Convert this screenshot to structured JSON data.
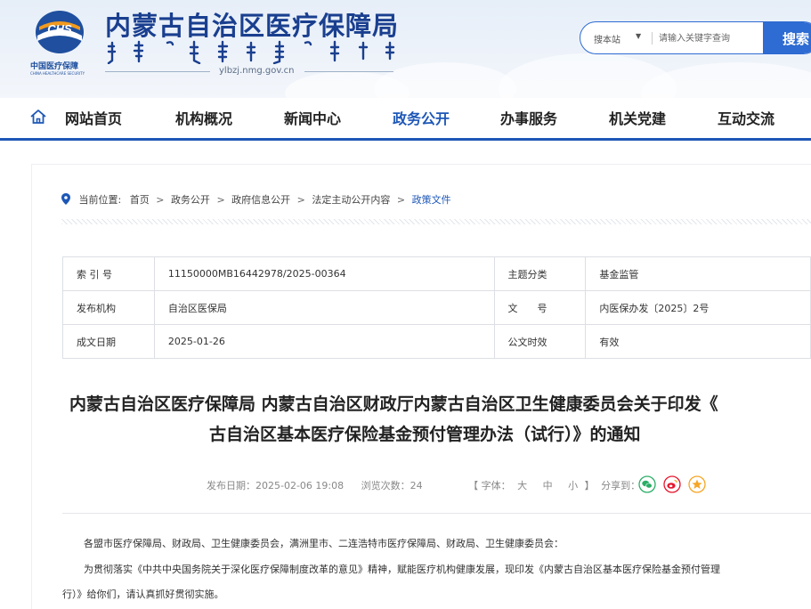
{
  "header": {
    "title": "内蒙古自治区医疗保障局",
    "domain": "ylbzj.nmg.gov.cn",
    "logo_abbr": "CHS",
    "logo_cn": "中国医疗保障",
    "logo_en": "CHINA HEALTHCARE SECURITY"
  },
  "search": {
    "scope": "搜本站",
    "placeholder": "请输入关键字查询",
    "button": "搜索"
  },
  "nav": {
    "items": [
      {
        "label": "网站首页"
      },
      {
        "label": "机构概况"
      },
      {
        "label": "新闻中心"
      },
      {
        "label": "政务公开"
      },
      {
        "label": "办事服务"
      },
      {
        "label": "机关党建"
      },
      {
        "label": "互动交流"
      }
    ],
    "active_index": 3
  },
  "breadcrumb": {
    "prefix": "当前位置:",
    "items": [
      "首页",
      "政务公开",
      "政府信息公开",
      "法定主动公开内容",
      "政策文件"
    ],
    "separator": ">"
  },
  "meta_table": [
    {
      "k1": "索 引 号",
      "v1": "11150000MB16442978/2025-00364",
      "k2": "主题分类",
      "v2": "基金监管"
    },
    {
      "k1": "发布机构",
      "v1": "自治区医保局",
      "k2": "文　　号",
      "v2": "内医保办发〔2025〕2号"
    },
    {
      "k1": "成文日期",
      "v1": "2025-01-26",
      "k2": "公文时效",
      "v2": "有效"
    }
  ],
  "article": {
    "title_line1": "内蒙古自治区医疗保障局 内蒙古自治区财政厅内蒙古自治区卫生健康委员会关于印发《",
    "title_line2": "古自治区基本医疗保险基金预付管理办法（试行）》的通知",
    "publish_label": "发布日期：2025-02-06 19:08",
    "views_label": "浏览次数：24",
    "font_label": "【 字体：",
    "font_large": "大",
    "font_medium": "中",
    "font_small": "小",
    "font_close": "】",
    "share_label": "分享到：",
    "para1": "各盟市医疗保障局、财政局、卫生健康委员会，满洲里市、二连浩特市医疗保障局、财政局、卫生健康委员会：",
    "para2": "为贯彻落实《中共中央国务院关于深化医疗保障制度改革的意见》精神，赋能医疗机构健康发展，现印发《内蒙古自治区基本医疗保险基金预付管理",
    "para3": "行）》给你们，请认真抓好贯彻实施。"
  },
  "colors": {
    "brand_blue": "#1d57b7",
    "title_blue": "#1a3f8f",
    "wechat_green": "#2aae67",
    "weibo_red": "#e6162d",
    "favorite_orange": "#f5a623"
  }
}
